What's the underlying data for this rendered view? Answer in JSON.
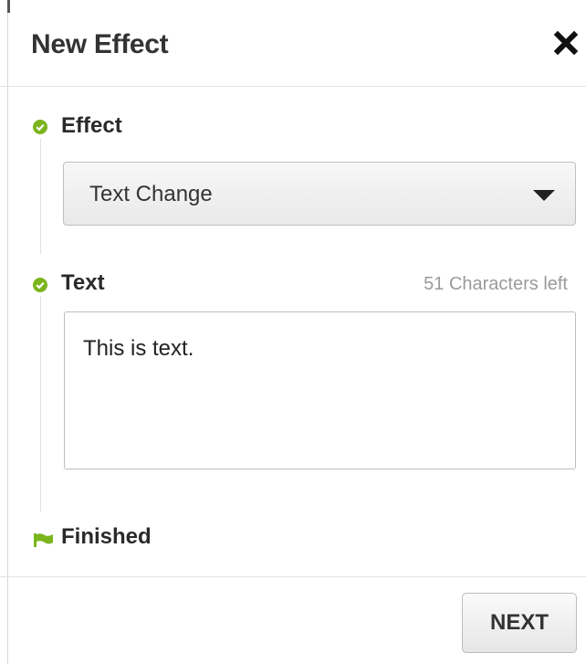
{
  "header": {
    "title": "New Effect",
    "close_icon": "close-x-icon"
  },
  "steps": [
    {
      "label": "Effect",
      "icon": "check-circle-icon",
      "state": "complete"
    },
    {
      "label": "Text",
      "icon": "check-circle-icon",
      "state": "complete"
    },
    {
      "label": "Finished",
      "icon": "flag-icon",
      "state": "final"
    }
  ],
  "effect_select": {
    "value": "Text Change",
    "icon": "caret-down-icon"
  },
  "text_field": {
    "value": "This is text.",
    "char_count": "51 Characters left"
  },
  "footer": {
    "next_label": "NEXT"
  },
  "colors": {
    "accent_green": "#7ab51d"
  }
}
